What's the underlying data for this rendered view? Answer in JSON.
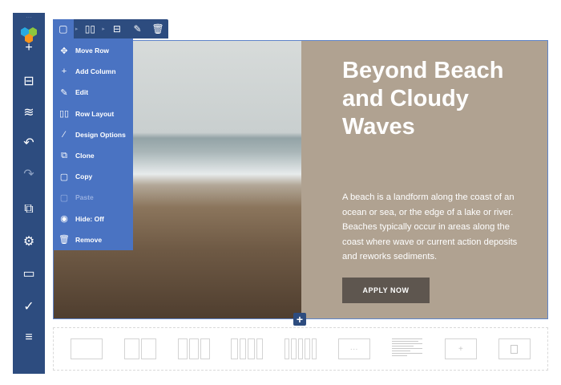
{
  "sidebar": {
    "items": [
      {
        "icon": "plus-icon",
        "glyph": "+"
      },
      {
        "icon": "element-icon",
        "glyph": "⊟"
      },
      {
        "icon": "layers-icon",
        "glyph": "≋"
      },
      {
        "icon": "undo-icon",
        "glyph": "↶"
      },
      {
        "icon": "redo-icon",
        "glyph": "↷"
      },
      {
        "icon": "responsive-icon",
        "glyph": "⧉"
      },
      {
        "icon": "settings-icon",
        "glyph": "⚙"
      },
      {
        "icon": "template-icon",
        "glyph": "▭"
      },
      {
        "icon": "save-check-icon",
        "glyph": "✓"
      },
      {
        "icon": "menu-icon",
        "glyph": "≡"
      }
    ]
  },
  "toolbar": {
    "row_icon": "▢",
    "column_icon": "▯▯",
    "save_icon": "⊟",
    "edit_icon": "✎",
    "delete_icon": "🗑"
  },
  "menu": {
    "items": [
      {
        "label": "Move Row",
        "glyph": "✥"
      },
      {
        "label": "Add Column",
        "glyph": "+"
      },
      {
        "label": "Edit",
        "glyph": "✎"
      },
      {
        "label": "Row Layout",
        "glyph": "▯▯"
      },
      {
        "label": "Design Options",
        "glyph": "⁄"
      },
      {
        "label": "Clone",
        "glyph": "⧉"
      },
      {
        "label": "Copy",
        "glyph": "▢"
      },
      {
        "label": "Paste",
        "glyph": "▢",
        "disabled": true
      },
      {
        "label": "Hide: Off",
        "glyph": "◉"
      },
      {
        "label": "Remove",
        "glyph": "🗑"
      }
    ]
  },
  "hero": {
    "title": "Beyond Beach and Cloudy Waves",
    "description": "A beach is a landform along the coast of an ocean or sea, or the edge of a lake or river. Beaches typically occur in areas along the coast where wave or current action deposits and reworks sediments.",
    "button": "APPLY NOW"
  },
  "add_row": "+",
  "layouts": {
    "more": "···",
    "add": "+"
  },
  "colors": {
    "sidebar": "#2d4c7f",
    "menu": "#4a73c2",
    "panel": "#b0a291",
    "button": "#5e564f"
  }
}
